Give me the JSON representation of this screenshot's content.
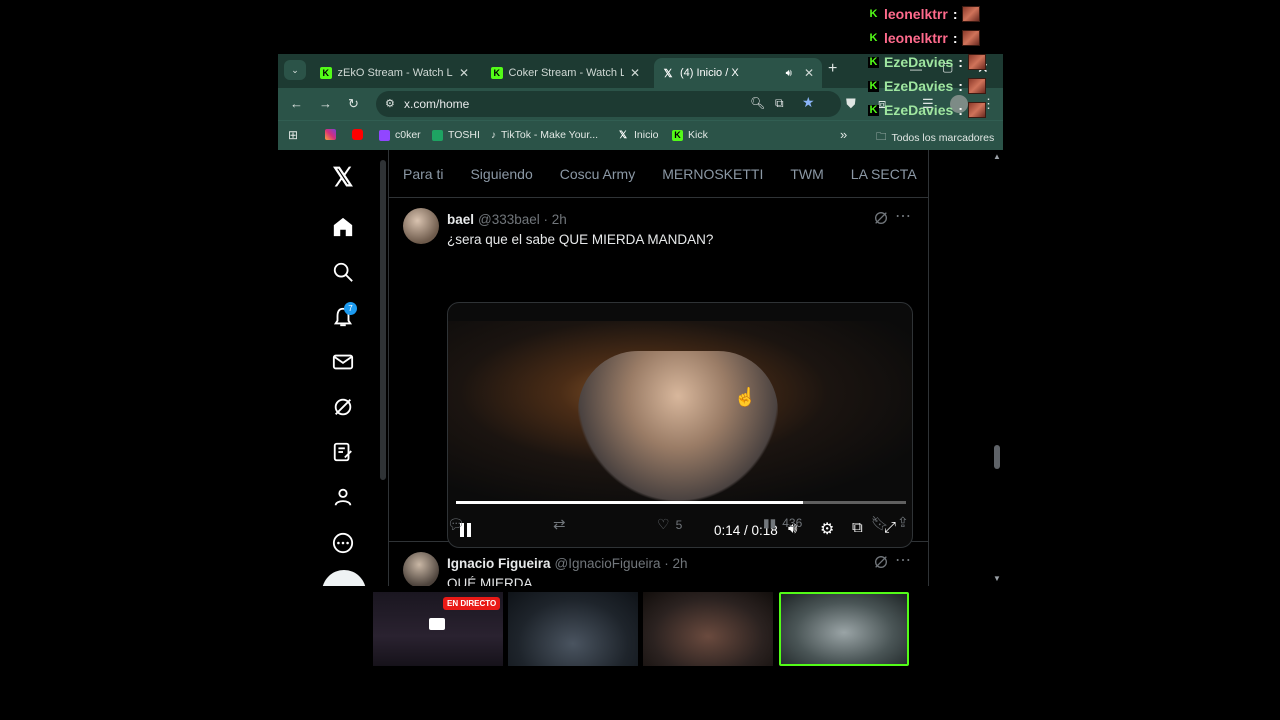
{
  "browser": {
    "tabs": [
      {
        "label": "zEkO Stream - Watch Live",
        "icon": "kick-icon"
      },
      {
        "label": "Coker Stream - Watch Live",
        "icon": "kick-icon"
      },
      {
        "label": "(4) Inicio / X",
        "icon": "x-icon",
        "active": true
      }
    ],
    "new_tab": "+",
    "url": "x.com/home",
    "bookmarks": [
      {
        "label": "",
        "icon": "instagram-icon"
      },
      {
        "label": "",
        "icon": "youtube-icon"
      },
      {
        "label": "c0ker",
        "icon": "twitch-icon"
      },
      {
        "label": "TOSHI",
        "icon": "sheets-icon"
      },
      {
        "label": "TikTok - Make Your...",
        "icon": "tiktok-icon"
      },
      {
        "label": "Inicio",
        "icon": "x-icon"
      },
      {
        "label": "Kick",
        "icon": "kick-icon"
      }
    ],
    "bookmarks_more": "»",
    "all_bookmarks": "Todos los marcadores"
  },
  "x": {
    "feed_tabs": [
      "Para ti",
      "Siguiendo",
      "Coscu Army",
      "MERNOSKETTI",
      "TWM",
      "LA SECTA"
    ],
    "notifications_badge": "7",
    "tweets": [
      {
        "name": "bael",
        "handle": "@333bael · 2h",
        "text": "¿sera que el sabe QUE MIERDA MANDAN?",
        "video": {
          "time": "0:14 / 0:18",
          "progress": 0.77
        },
        "replies": "",
        "retweets": "",
        "likes": "5",
        "views": "436"
      },
      {
        "name": "Ignacio Figueira",
        "handle": "@IgnacioFigueira · 2h",
        "text": "QUÉ MIERDA"
      }
    ]
  },
  "chat": [
    {
      "user": "leonelktrr",
      "sep": ":",
      "color": "#ff6a8c"
    },
    {
      "user": "leonelktrr",
      "sep": ":",
      "color": "#ff6a8c"
    },
    {
      "user": "EzeDavies",
      "sep": ":",
      "color": "#9fe6a0"
    },
    {
      "user": "EzeDavies",
      "sep": ":",
      "color": "#9fe6a0"
    },
    {
      "user": "EzeDavies",
      "sep": ":",
      "color": "#9fe6a0"
    }
  ],
  "cams": [
    {
      "badge": "EN DIRECTO"
    },
    {},
    {},
    {
      "active": true
    }
  ],
  "colors": {
    "tab_bg": "#1d3a32",
    "toolbar_bg": "#2b5348",
    "x_blue": "#1d9bf0",
    "kick_green": "#53fc18",
    "live_red": "#e91916"
  }
}
